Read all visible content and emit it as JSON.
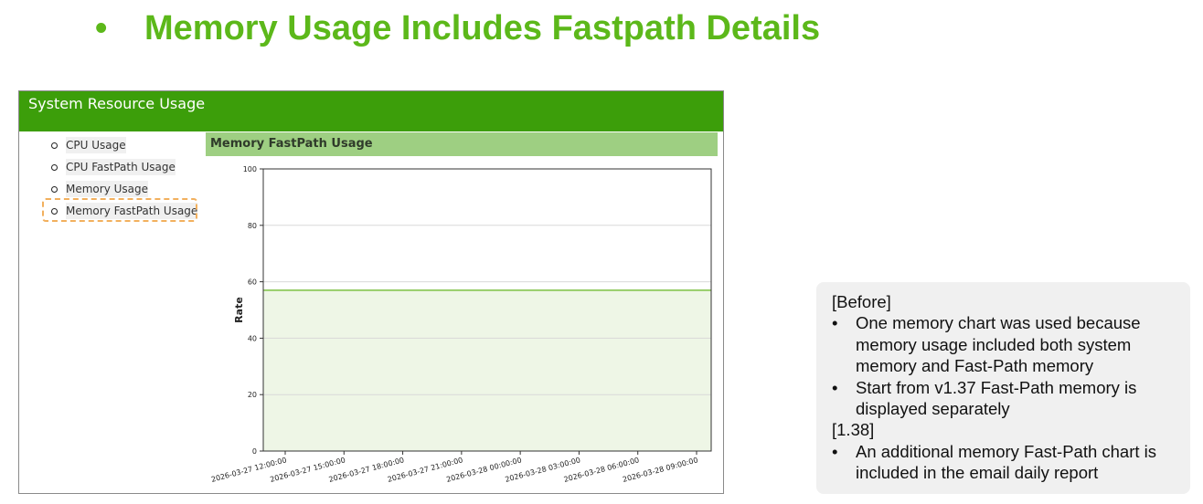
{
  "slide": {
    "bullet": "•",
    "title": "Memory Usage Includes Fastpath Details"
  },
  "panel": {
    "header": "System Resource Usage",
    "menu": [
      {
        "label": "CPU Usage"
      },
      {
        "label": "CPU FastPath Usage"
      },
      {
        "label": "Memory Usage"
      },
      {
        "label": "Memory FastPath Usage"
      }
    ],
    "selected_index": 3
  },
  "chart_data": {
    "type": "area",
    "title": "Memory FastPath Usage",
    "xlabel": "",
    "ylabel": "Rate",
    "ylim": [
      0,
      100
    ],
    "yticks": [
      0,
      20,
      40,
      60,
      80,
      100
    ],
    "x": [
      "2026-03-27 12:00:00",
      "2026-03-27 15:00:00",
      "2026-03-27 18:00:00",
      "2026-03-27 21:00:00",
      "2026-03-28 00:00:00",
      "2026-03-28 03:00:00",
      "2026-03-28 06:00:00",
      "2026-03-28 09:00:00"
    ],
    "values": [
      57,
      57,
      57,
      57,
      57,
      57,
      57,
      57
    ],
    "grid": true,
    "colors": {
      "line": "#7cc142",
      "fill": "#eef6e6",
      "grid": "#d9d9d9"
    }
  },
  "notes": {
    "sections": [
      {
        "heading": "[Before]",
        "items": [
          "One memory chart was used because memory usage included both system memory and Fast-Path memory",
          "Start from v1.37 Fast-Path memory is displayed separately"
        ]
      },
      {
        "heading": "[1.38]",
        "items": [
          "An additional memory Fast-Path chart is included in the email daily report"
        ]
      }
    ]
  }
}
